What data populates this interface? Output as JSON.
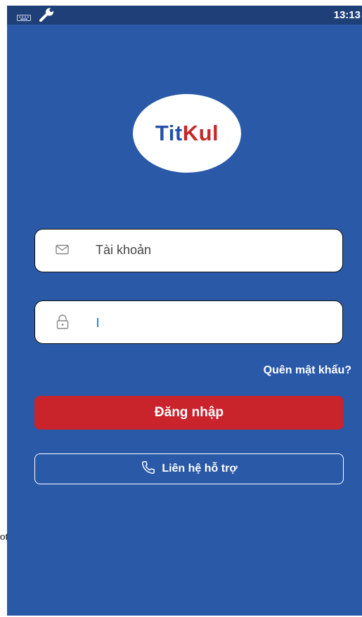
{
  "status_bar": {
    "time": "13:13",
    "icons": [
      "keyboard-icon",
      "wrench-icon"
    ]
  },
  "logo": {
    "part1": "Tit",
    "part2": "Kul"
  },
  "username": {
    "placeholder": "Tài khoản",
    "icon": "mail-icon"
  },
  "password": {
    "value": "",
    "icon": "lock-icon"
  },
  "forgot_password": "Quên mật khẩu?",
  "login_button": "Đăng nhập",
  "support_button": {
    "label": "Liên hệ hỗ trợ",
    "icon": "phone-icon"
  },
  "stray_text": "ot",
  "colors": {
    "background": "#2a59a8",
    "status_bar": "#1f3f78",
    "primary_button": "#c9232b",
    "logo_blue": "#2350a8",
    "logo_red": "#c62828"
  }
}
